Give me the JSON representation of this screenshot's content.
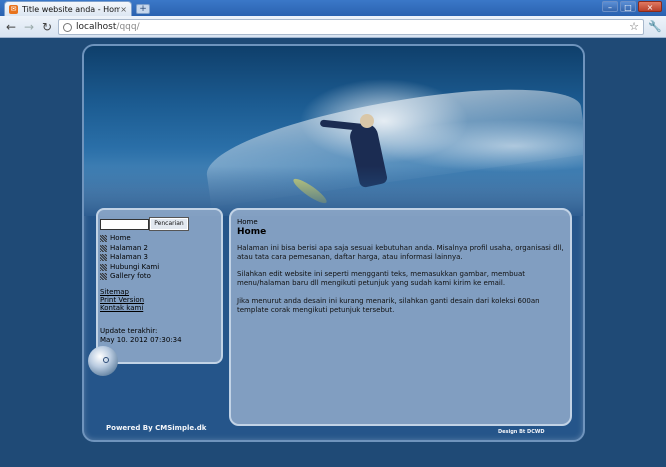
{
  "browser": {
    "tab_title": "Title website anda - Home",
    "tab_close": "×",
    "new_tab": "+",
    "window_controls": {
      "minimize": "–",
      "maximize": "□",
      "close": "×"
    },
    "nav": {
      "back": "←",
      "forward": "→",
      "reload": "↻"
    },
    "url_host": "localhost",
    "url_path": "/qqq/",
    "bookmark_icon": "☆",
    "menu_icon": "🔧"
  },
  "site": {
    "search_button": "Pencarian",
    "menu": [
      "Home",
      "Halaman 2",
      "Halaman 3",
      "Hubungi Kami",
      "Gallery foto"
    ],
    "links": [
      "Sitemap",
      "Print Version",
      "Kontak kami"
    ],
    "update_label": "Update terakhir:",
    "update_date": "May 10. 2012 07:30:34",
    "breadcrumb": "Home",
    "page_title": "Home",
    "paragraphs": [
      "Halaman ini bisa berisi apa saja sesuai kebutuhan anda. Misalnya profil usaha, organisasi dll, atau tata cara pemesanan, daftar harga, atau informasi lainnya.",
      "Silahkan edit website ini seperti mengganti teks, memasukkan gambar, membuat menu/halaman baru dll mengikuti petunjuk yang sudah kami kirim ke email.",
      "Jika menurut anda desain ini kurang menarik, silahkan ganti desain dari koleksi 600an template corak mengikuti petunjuk tersebut."
    ],
    "powered_by": "Powered By CMSimple.dk",
    "design_by": "Design Bt DCWD"
  }
}
